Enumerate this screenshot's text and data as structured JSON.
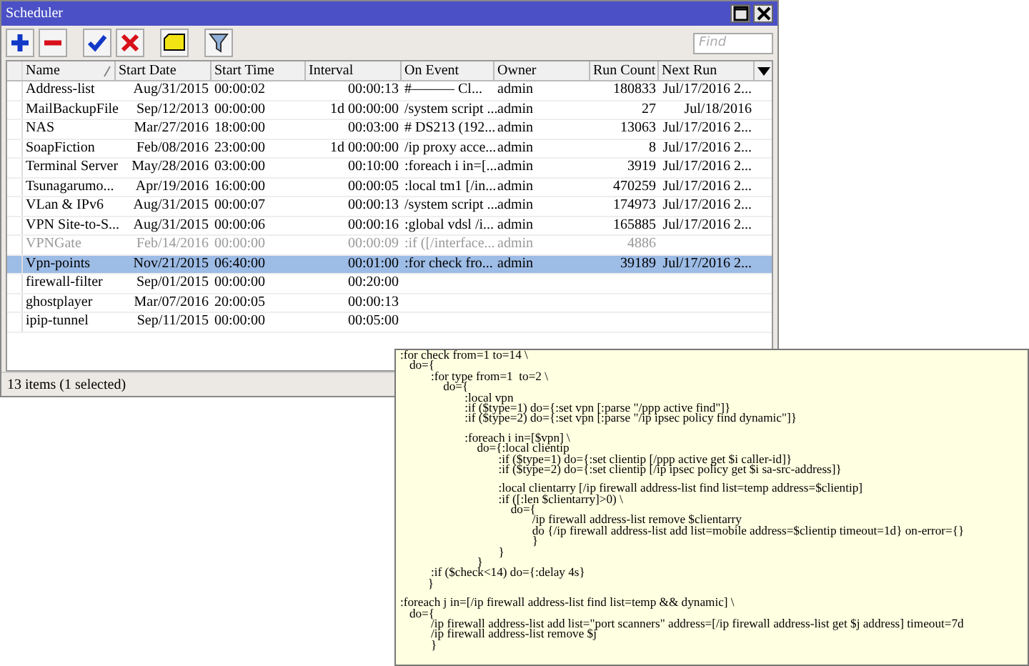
{
  "window": {
    "title": "Scheduler"
  },
  "search": {
    "placeholder": "Find"
  },
  "table": {
    "columns": [
      "Name",
      "Start Date",
      "Start Time",
      "Interval",
      "On Event",
      "Owner",
      "Run Count",
      "Next Run"
    ],
    "rows": [
      {
        "name": "Address-list",
        "start_date": "Aug/31/2015",
        "start_time": "00:00:02",
        "interval": "00:00:13",
        "on_event": "#——— Cl...",
        "owner": "admin",
        "run_count": "180833",
        "next_run": "Jul/17/2016 2...",
        "disabled": false,
        "selected": false
      },
      {
        "name": "MailBackupFile",
        "start_date": "Sep/12/2013",
        "start_time": "00:00:00",
        "interval": "1d 00:00:00",
        "on_event": "/system script ...",
        "owner": "admin",
        "run_count": "27",
        "next_run": "Jul/18/2016",
        "disabled": false,
        "selected": false
      },
      {
        "name": "NAS",
        "start_date": "Mar/27/2016",
        "start_time": "18:00:00",
        "interval": "00:03:00",
        "on_event": "# DS213 (192...",
        "owner": "admin",
        "run_count": "13063",
        "next_run": "Jul/17/2016 2...",
        "disabled": false,
        "selected": false
      },
      {
        "name": "SoapFiction",
        "start_date": "Feb/08/2016",
        "start_time": "23:00:00",
        "interval": "1d 00:00:00",
        "on_event": "/ip proxy acce...",
        "owner": "admin",
        "run_count": "8",
        "next_run": "Jul/17/2016 2...",
        "disabled": false,
        "selected": false
      },
      {
        "name": "Terminal Server",
        "start_date": "May/28/2016",
        "start_time": "03:00:00",
        "interval": "00:10:00",
        "on_event": ":foreach i in=[...",
        "owner": "admin",
        "run_count": "3919",
        "next_run": "Jul/17/2016 2...",
        "disabled": false,
        "selected": false
      },
      {
        "name": "Tsunagarumo...",
        "start_date": "Apr/19/2016",
        "start_time": "16:00:00",
        "interval": "00:00:05",
        "on_event": ":local tm1 [/in...",
        "owner": "admin",
        "run_count": "470259",
        "next_run": "Jul/17/2016 2...",
        "disabled": false,
        "selected": false
      },
      {
        "name": "VLan & IPv6",
        "start_date": "Aug/31/2015",
        "start_time": "00:00:07",
        "interval": "00:00:13",
        "on_event": "/system script ...",
        "owner": "admin",
        "run_count": "174973",
        "next_run": "Jul/17/2016 2...",
        "disabled": false,
        "selected": false
      },
      {
        "name": "VPN Site-to-S...",
        "start_date": "Aug/31/2015",
        "start_time": "00:00:06",
        "interval": "00:00:16",
        "on_event": ":global vdsl  /i...",
        "owner": "admin",
        "run_count": "165885",
        "next_run": "Jul/17/2016 2...",
        "disabled": false,
        "selected": false
      },
      {
        "name": "VPNGate",
        "start_date": "Feb/14/2016",
        "start_time": "00:00:00",
        "interval": "00:00:09",
        "on_event": ":if ([/interface...",
        "owner": "admin",
        "run_count": "4886",
        "disabled": true,
        "selected": false
      },
      {
        "name": "Vpn-points",
        "start_date": "Nov/21/2015",
        "start_time": "06:40:00",
        "interval": "00:01:00",
        "on_event": ":for check fro...",
        "owner": "admin",
        "run_count": "39189",
        "next_run": "Jul/17/2016 2...",
        "disabled": false,
        "selected": true
      },
      {
        "name": "firewall-filter",
        "start_date": "Sep/01/2015",
        "start_time": "00:00:00",
        "interval": "00:20:00",
        "disabled": false,
        "selected": false
      },
      {
        "name": "ghostplayer",
        "start_date": "Mar/07/2016",
        "start_time": "20:00:05",
        "interval": "00:00:13",
        "disabled": false,
        "selected": false
      },
      {
        "name": "ipip-tunnel",
        "start_date": "Sep/11/2015",
        "start_time": "00:00:00",
        "interval": "00:05:00",
        "disabled": false,
        "selected": false
      }
    ]
  },
  "status_bar": "13 items (1 selected)",
  "tooltip": {
    "blocks": [
      {
        "lines": [
          ":for check from=1 to=14 \\",
          "   do={",
          "          :for type from=1  to=2 \\",
          "              do={",
          "                     :local vpn",
          "                     :if ($type=1) do={:set vpn [:parse \"/ppp active find\"]}",
          "                     :if ($type=2) do={:set vpn [:parse \"/ip ipsec policy find dynamic\"]}"
        ]
      },
      {
        "lines": [
          "                     :foreach i in=[$vpn] \\",
          "                         do={:local clientip",
          "                                :if ($type=1) do={:set clientip [/ppp active get $i caller-id]}",
          "                                :if ($type=2) do={:set clientip [/ip ipsec policy get $i sa-src-address]}"
        ]
      },
      {
        "lines": [
          "                                :local clientarry [/ip firewall address-list find list=temp address=$clientip]",
          "                                :if ([:len $clientarry]>0) \\",
          "                                    do={",
          "                                           /ip firewall address-list remove $clientarry",
          "                                           do {/ip firewall address-list add list=mobile address=$clientip timeout=1d} on-error={}",
          "                                           }",
          "                                }",
          "                         }",
          "          :if ($check<14) do={:delay 4s}",
          "         }"
        ]
      },
      {
        "lines": [
          ":foreach j in=[/ip firewall address-list find list=temp && dynamic] \\",
          "   do={",
          "          /ip firewall address-list add list=\"port scanners\" address=[/ip firewall address-list get $j address] timeout=7d",
          "          /ip firewall address-list remove $j",
          "          }"
        ]
      }
    ]
  }
}
